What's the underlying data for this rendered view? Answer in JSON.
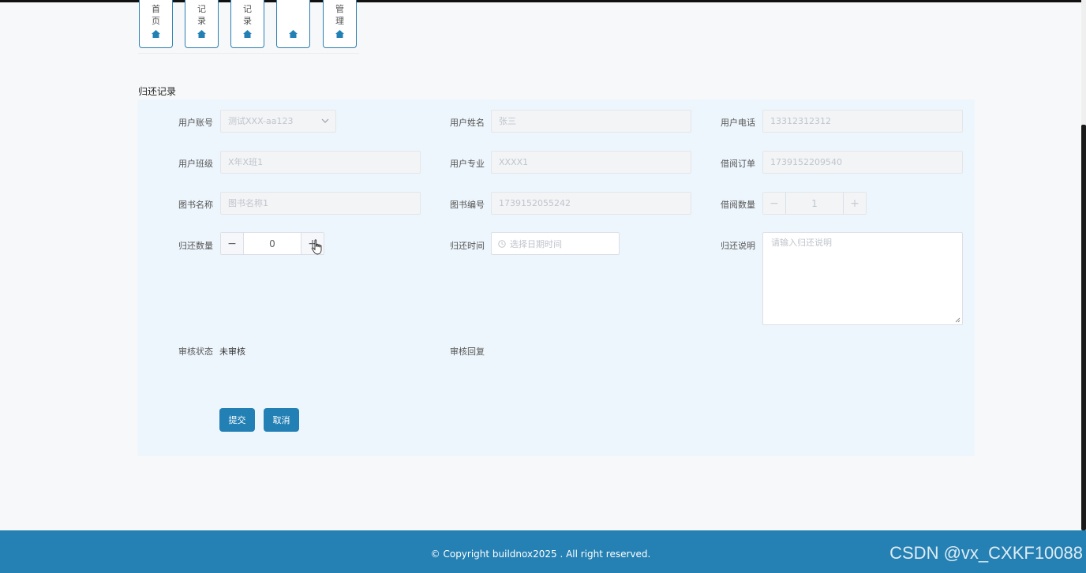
{
  "nav": {
    "items": [
      {
        "chars": [
          "首",
          "页"
        ]
      },
      {
        "chars": [
          "记",
          "录"
        ]
      },
      {
        "chars": [
          "记",
          "录"
        ]
      },
      {
        "chars": []
      },
      {
        "chars": [
          "管",
          "理"
        ]
      }
    ],
    "icon": "home-icon"
  },
  "section_title": "归还记录",
  "form": {
    "user_account": {
      "label": "用户账号",
      "value": "测试XXX-aa123"
    },
    "user_name": {
      "label": "用户姓名",
      "value": "张三"
    },
    "user_phone": {
      "label": "用户电话",
      "value": "13312312312"
    },
    "user_class": {
      "label": "用户班级",
      "value": "X年X班1"
    },
    "user_major": {
      "label": "用户专业",
      "value": "XXXX1"
    },
    "borrow_order": {
      "label": "借阅订单",
      "value": "1739152209540"
    },
    "book_name": {
      "label": "图书名称",
      "value": "图书名称1"
    },
    "book_code": {
      "label": "图书编号",
      "value": "1739152055242"
    },
    "borrow_qty": {
      "label": "借阅数量",
      "value": "1",
      "minus": "−",
      "plus": "+"
    },
    "return_qty": {
      "label": "归还数量",
      "value": "0",
      "minus": "−",
      "plus": "+"
    },
    "return_time": {
      "label": "归还时间",
      "placeholder": "选择日期时间"
    },
    "return_note": {
      "label": "归还说明",
      "placeholder": "请输入归还说明"
    },
    "review_status": {
      "label": "审核状态",
      "value": "未审核"
    },
    "review_reply": {
      "label": "审核回复"
    }
  },
  "buttons": {
    "submit": "提交",
    "cancel": "取消"
  },
  "footer": {
    "copyright": "© Copyright buildnox2025 . All right reserved.",
    "watermark": "CSDN @vx_CXKF10088"
  },
  "colors": {
    "accent": "#2380b4",
    "footer": "#2580b3",
    "panel": "#eef6fd"
  }
}
